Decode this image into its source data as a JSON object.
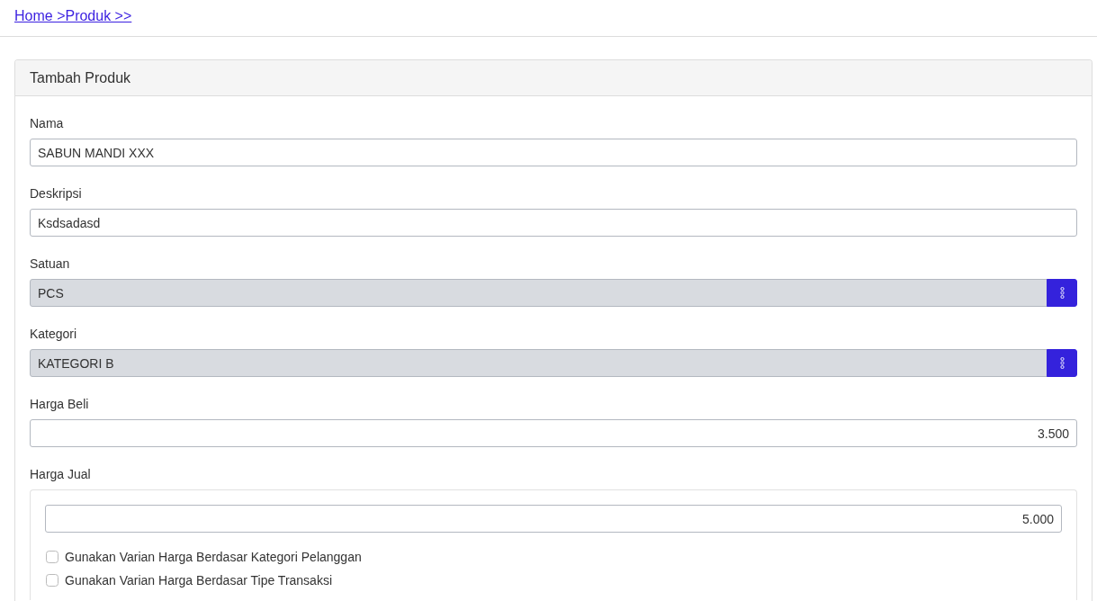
{
  "breadcrumb": {
    "text": "Home >Produk >>"
  },
  "card": {
    "title": "Tambah Produk",
    "fields": [
      {
        "kind": "text",
        "label": "Nama",
        "value": "SABUN MANDI XXX"
      },
      {
        "kind": "text",
        "label": "Deskripsi",
        "value": "Ksdsadasd"
      },
      {
        "kind": "lookup",
        "label": "Satuan",
        "value": "PCS"
      },
      {
        "kind": "lookup",
        "label": "Kategori",
        "value": "KATEGORI B"
      },
      {
        "kind": "number",
        "label": "Harga Beli",
        "value": "3.500"
      },
      {
        "kind": "price_group",
        "label": "Harga Jual",
        "value": "5.000",
        "options": [
          {
            "label": "Gunakan Varian Harga Berdasar Kategori Pelanggan",
            "checked": false
          },
          {
            "label": "Gunakan Varian Harga Berdasar Tipe Transaksi",
            "checked": false
          }
        ]
      }
    ]
  }
}
